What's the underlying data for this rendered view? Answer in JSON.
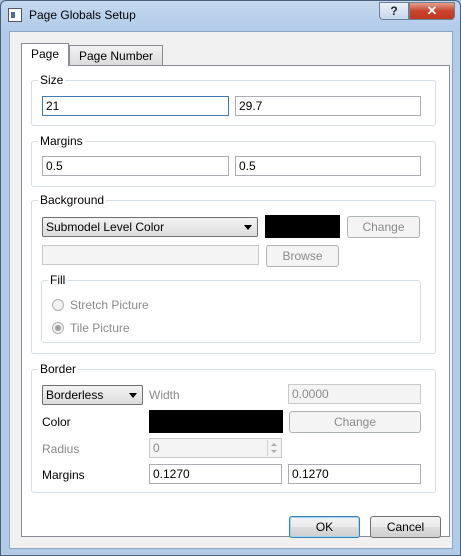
{
  "window": {
    "title": "Page Globals Setup",
    "help_label": "?",
    "close_label": "✕"
  },
  "tabs": [
    {
      "label": "Page",
      "active": true
    },
    {
      "label": "Page Number",
      "active": false
    }
  ],
  "size": {
    "group_label": "Size",
    "width_value": "21",
    "height_value": "29.7"
  },
  "margins": {
    "group_label": "Margins",
    "left_value": "0.5",
    "right_value": "0.5"
  },
  "background": {
    "group_label": "Background",
    "type_selected": "Submodel Level Color",
    "color": "#000000",
    "change_label": "Change",
    "picture_path": "",
    "browse_label": "Browse",
    "fill": {
      "group_label": "Fill",
      "stretch_label": "Stretch Picture",
      "tile_label": "Tile Picture",
      "selected": "Tile Picture"
    }
  },
  "border": {
    "group_label": "Border",
    "type_selected": "Borderless",
    "width_label": "Width",
    "width_value": "0.0000",
    "color_label": "Color",
    "color": "#000000",
    "change_label": "Change",
    "radius_label": "Radius",
    "radius_value": "0",
    "margins_label": "Margins",
    "margin_left_value": "0.1270",
    "margin_right_value": "0.1270"
  },
  "footer": {
    "ok_label": "OK",
    "cancel_label": "Cancel"
  }
}
